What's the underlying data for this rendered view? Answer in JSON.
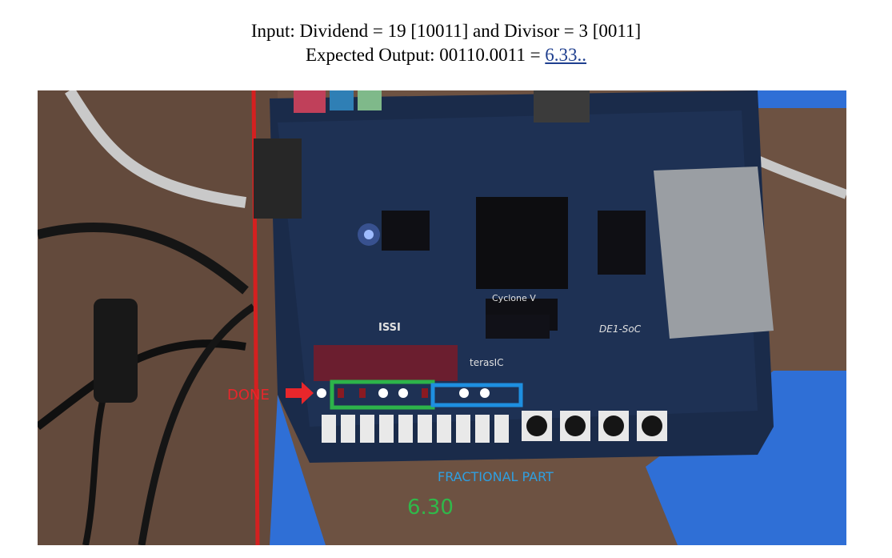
{
  "header": {
    "line1": "Input: Dividend = 19 [10011] and Divisor = 3 [0011]",
    "line2_prefix": "Expected Output: 00110.0011 = ",
    "line2_value": "6.33.."
  },
  "photo": {
    "annotations": {
      "done": "DONE",
      "fractional_part": "FRACTIONAL PART",
      "result": "6.30"
    },
    "board_text": {
      "brand": "Cyclone V",
      "model": "DE1-SoC",
      "maker": "terasIC",
      "chip": "ISSI"
    },
    "colors": {
      "done": "#e8262b",
      "integer_box": "#2db34a",
      "fractional_box": "#1e8fe0",
      "result": "#30b84a"
    }
  }
}
